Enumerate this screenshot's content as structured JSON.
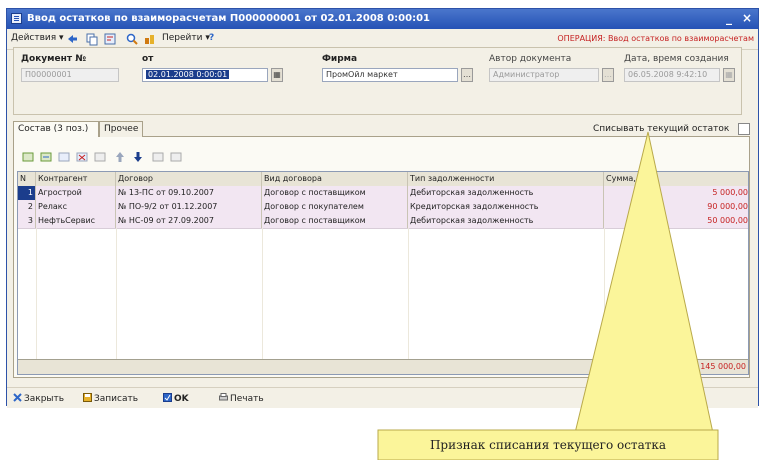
{
  "window": {
    "title": "Ввод остатков по взаиморасчетам П000000001 от 02.01.2008 0:00:01",
    "minimize_glyph": "_",
    "close_glyph": "×"
  },
  "menubar": {
    "actions": "Действия ▾",
    "goto": "Перейти ▾",
    "help": "?",
    "operation": "ОПЕРАЦИЯ: Ввод остатков по взаиморасчетам"
  },
  "header": {
    "doc_no_label": "Документ №",
    "doc_no_value": "П00000001",
    "date_label": "от",
    "date_value": "02.01.2008 0:00:01",
    "firm_label": "Фирма",
    "firm_value": "ПромОйл маркет",
    "author_label": "Автор документа",
    "author_value": "Администратор",
    "created_label": "Дата, время создания",
    "created_value": "06.05.2008 9:42:10"
  },
  "tabs": [
    {
      "label": "Состав (3 поз.)"
    },
    {
      "label": "Прочее"
    }
  ],
  "writeoff": {
    "label": "Списывать текущий остаток"
  },
  "table": {
    "columns": [
      "N",
      "Контрагент",
      "Договор",
      "Вид договора",
      "Тип задолженности",
      "Сумма, руб"
    ],
    "rows": [
      {
        "n": "1",
        "counterparty": "Агрострой",
        "contract": "№ 13-ПС от 09.10.2007",
        "contract_type": "Договор с поставщиком",
        "debt_type": "Дебиторская задолженность",
        "amount": "5 000,00"
      },
      {
        "n": "2",
        "counterparty": "Релакс",
        "contract": "№ ПО-9/2 от 01.12.2007",
        "contract_type": "Договор с покупателем",
        "debt_type": "Кредиторская задолженность",
        "amount": "90 000,00"
      },
      {
        "n": "3",
        "counterparty": "НефтьСервис",
        "contract": "№ НС-09 от 27.09.2007",
        "contract_type": "Договор с поставщиком",
        "debt_type": "Дебиторская задолженность",
        "amount": "50 000,00"
      }
    ],
    "total": "145 000,00"
  },
  "bottombar": {
    "close": "Закрыть",
    "save": "Записать",
    "ok": "OK",
    "print": "Печать"
  },
  "callout": {
    "text": "Признак списания текущего остатка"
  },
  "colors": {
    "title_bar": "#2552b5",
    "accent_red": "#c62222",
    "row_highlight": "#f2e6f2",
    "callout_fill": "#fbf59a"
  }
}
